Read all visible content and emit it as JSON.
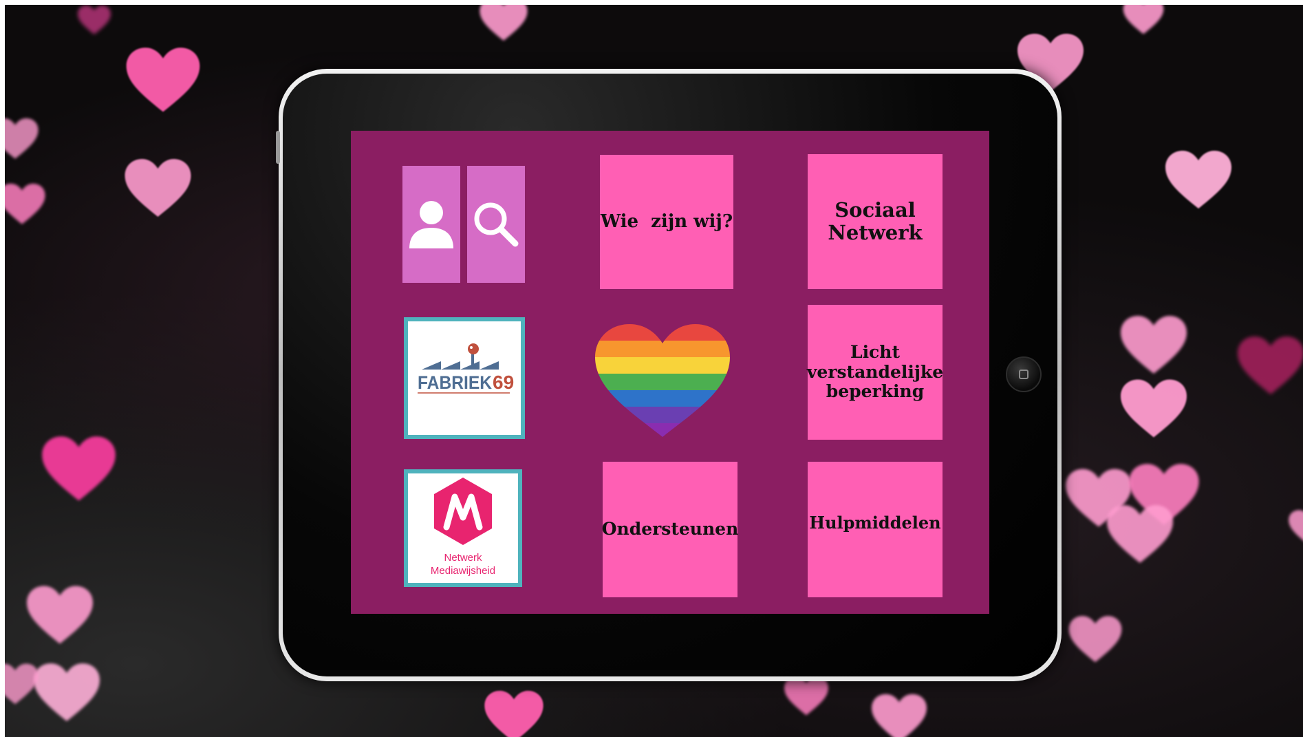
{
  "tiles": {
    "wie_zijn_wij": "Wie  zijn wij?",
    "sociaal_netwerk": [
      "Sociaal",
      "Netwerk"
    ],
    "licht_verstandelijke_beperking": [
      "Licht",
      "verstandelijke",
      "beperking"
    ],
    "ondersteunen": "Ondersteunen",
    "hulpmiddelen": "Hulpmiddelen"
  },
  "logos": {
    "fabriek": {
      "word": "FABRIEK",
      "number": "69"
    },
    "mediawijsheid": {
      "line1": "Netwerk",
      "line2": "Mediawijsheid"
    }
  },
  "icons": {
    "profile": "person-icon",
    "search": "search-icon",
    "heart": "rainbow-heart-icon"
  },
  "colors": {
    "screen_background": "#8b1e62",
    "tile_pink": "#ff5fb4",
    "icon_tile": "#d66cc6",
    "logo_border": "#4fb3bd",
    "rainbow": [
      "#e8473f",
      "#f7962e",
      "#f8d33a",
      "#4caf50",
      "#2e73c9",
      "#6a3fb2",
      "#8a2db0"
    ]
  }
}
